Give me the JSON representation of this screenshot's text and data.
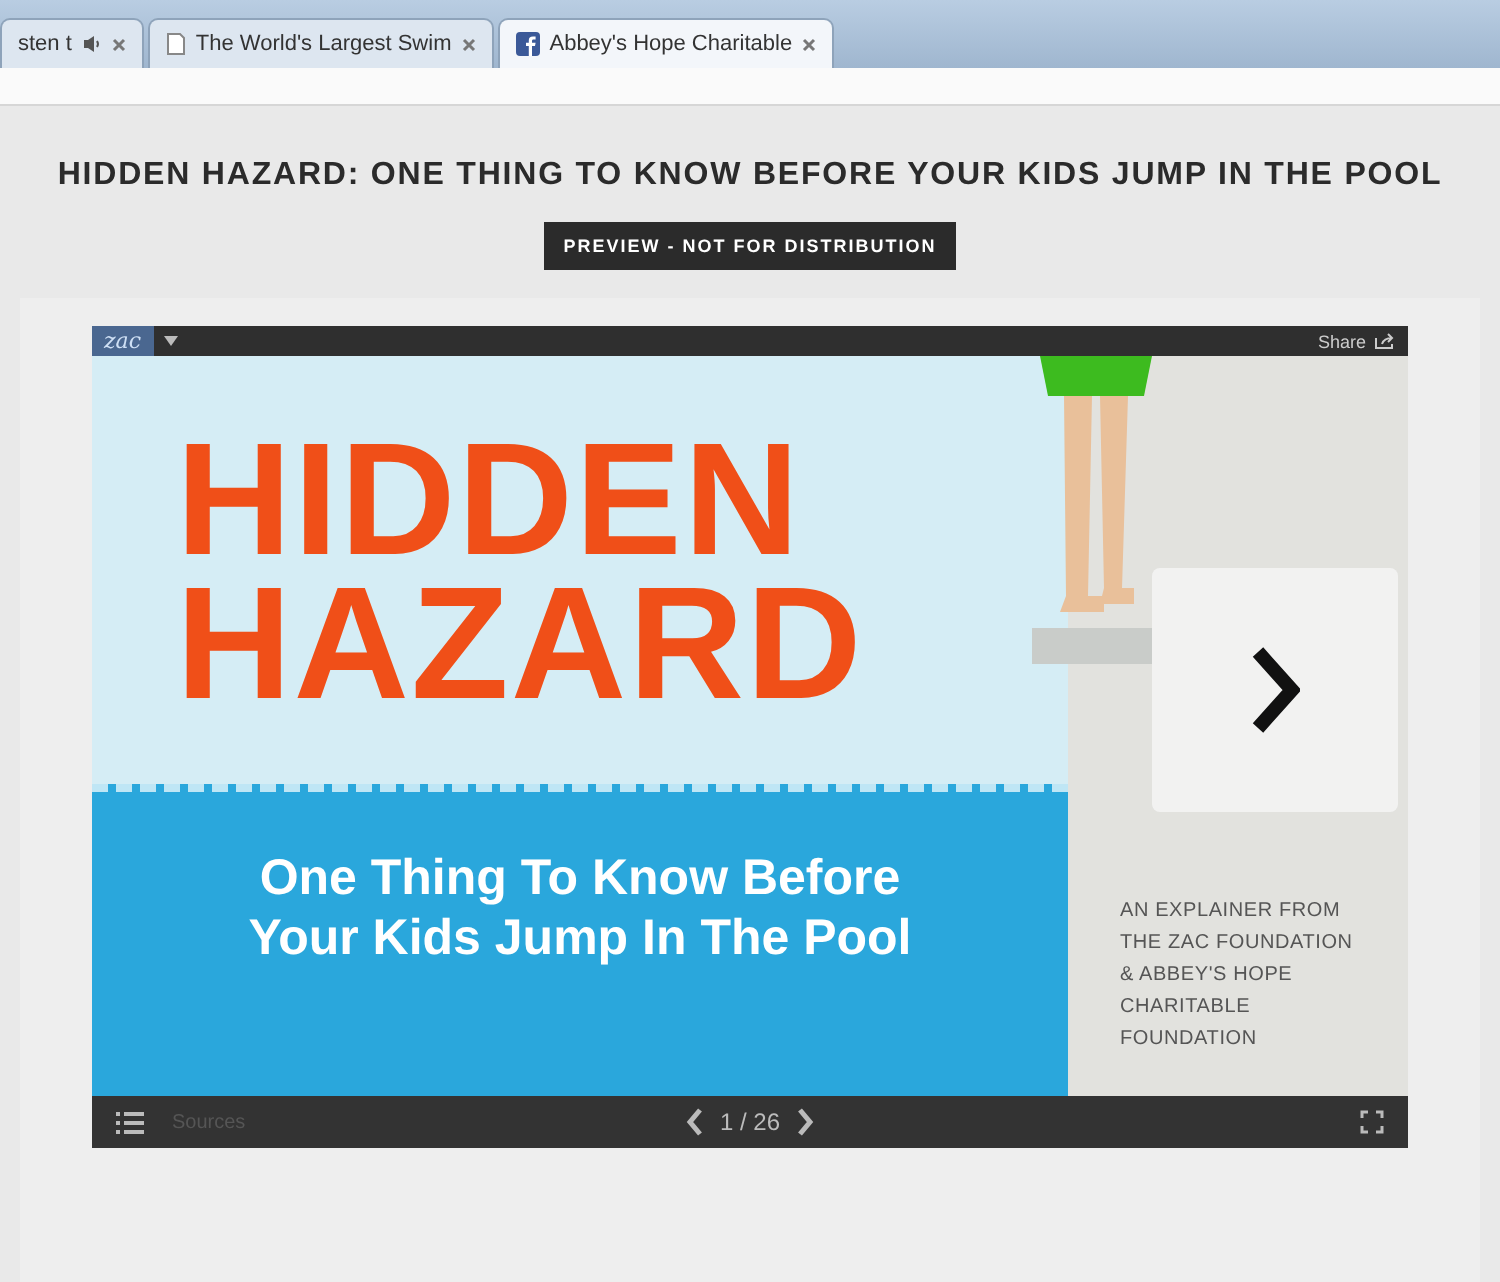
{
  "browser_tabs": [
    {
      "title": "sten t",
      "audio": true,
      "kind": "plain",
      "selected": false
    },
    {
      "title": "The World's Largest Swim",
      "audio": false,
      "kind": "page",
      "selected": false
    },
    {
      "title": "Abbey's Hope Charitable",
      "audio": false,
      "kind": "facebook",
      "selected": true
    }
  ],
  "page": {
    "headline": "HIDDEN HAZARD: ONE THING TO KNOW BEFORE YOUR KIDS JUMP IN THE POOL",
    "badge": "PREVIEW - NOT FOR DISTRIBUTION"
  },
  "player": {
    "logo": "zac",
    "share": "Share",
    "slide": {
      "title_lines": [
        "HIDDEN",
        "HAZARD"
      ],
      "subtitle_lines": [
        "One Thing To Know Before",
        "Your Kids Jump In The Pool"
      ],
      "credit": "AN EXPLAINER FROM THE ZAC FOUNDATION & ABBEY'S HOPE CHARITABLE FOUNDATION"
    },
    "sources": "Sources",
    "page_indicator": "1 / 26"
  }
}
